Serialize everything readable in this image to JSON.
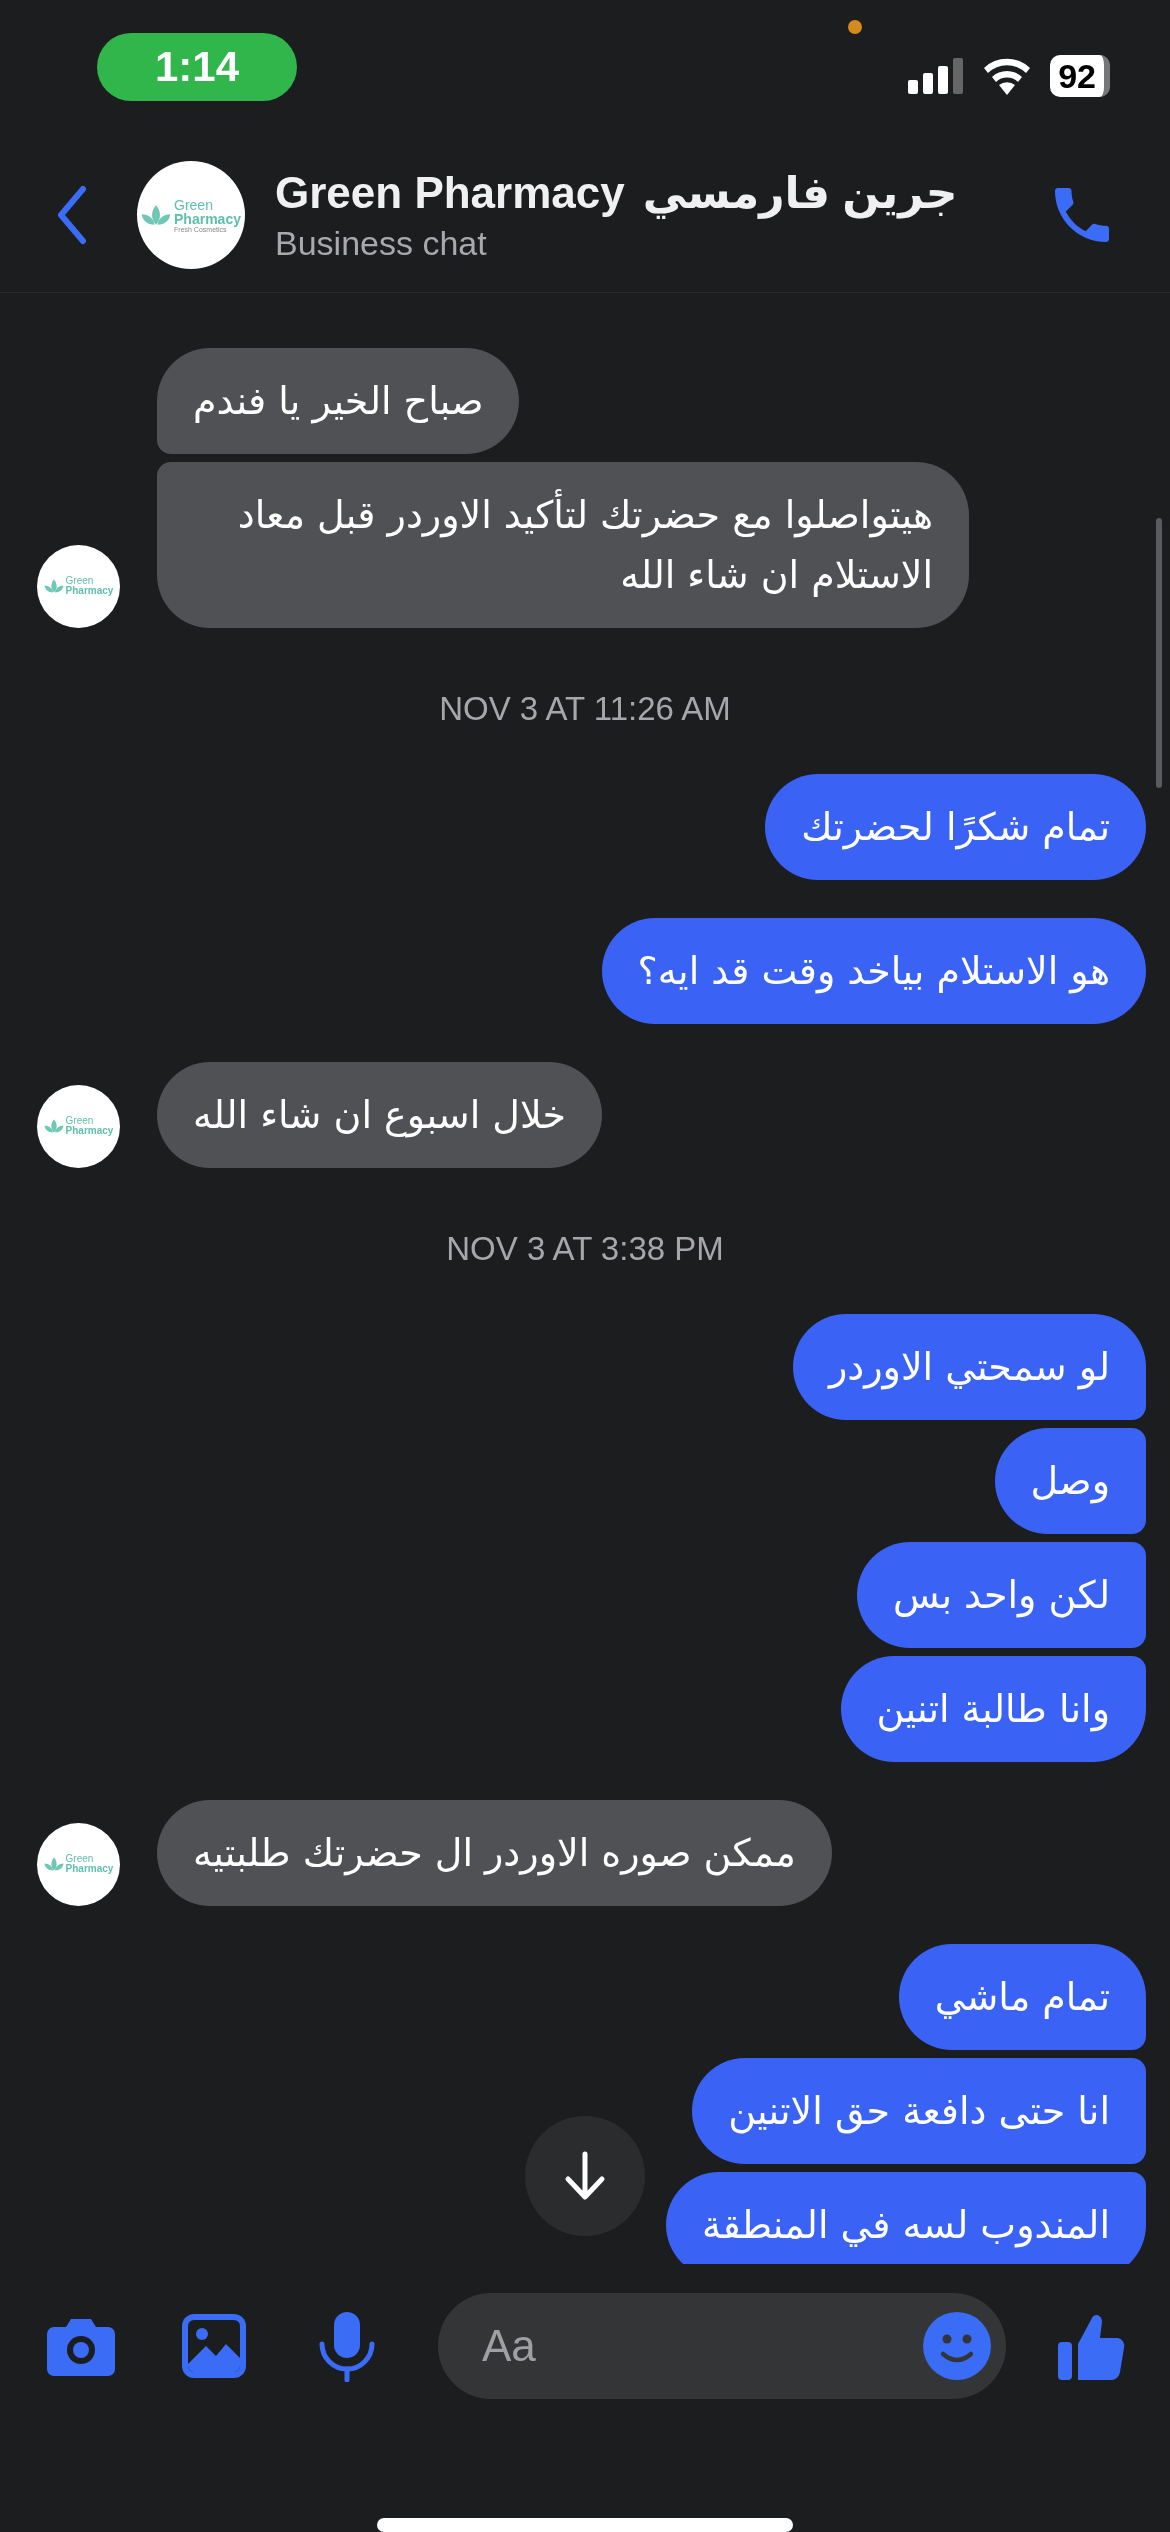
{
  "status_bar": {
    "time": "1:14",
    "battery": "92"
  },
  "header": {
    "title": "Green Pharmacy",
    "title_arabic": "جرين فارمسي",
    "subtitle": "Business chat",
    "logo": {
      "name_line_1": "Green",
      "name_line_2": "Pharmacy",
      "tagline": "Fresh Cosmetics"
    }
  },
  "messages": [
    {
      "kind": "incoming",
      "text": "صباح الخير يا فندم"
    },
    {
      "kind": "incoming",
      "text": "هيتواصلوا مع حضرتك لتأكيد الاوردر قبل معاد الاستلام ان شاء الله",
      "avatar": {
        "name_line_1": "Green",
        "name_line_2": "Pharmacy"
      }
    },
    {
      "kind": "timestamp",
      "text": "NOV 3 AT 11:26 AM"
    },
    {
      "kind": "outgoing",
      "text": "تمام شكرًا لحضرتك"
    },
    {
      "kind": "outgoing",
      "text": "هو الاستلام بياخد وقت قد ايه؟",
      "new_group": true
    },
    {
      "kind": "incoming",
      "text": "خلال اسبوع ان شاء الله",
      "avatar": {
        "name_line_1": "Green",
        "name_line_2": "Pharmacy"
      }
    },
    {
      "kind": "timestamp",
      "text": "NOV 3 AT 3:38 PM"
    },
    {
      "kind": "outgoing",
      "text": "لو سمحتي الاوردر"
    },
    {
      "kind": "outgoing",
      "text": "وصل"
    },
    {
      "kind": "outgoing",
      "text": "لكن واحد بس"
    },
    {
      "kind": "outgoing",
      "text": "وانا طالبة اتنين"
    },
    {
      "kind": "incoming",
      "text": "ممكن صوره الاوردر ال حضرتك طلبتيه",
      "avatar": {
        "name_line_1": "Green",
        "name_line_2": "Pharmacy"
      }
    },
    {
      "kind": "outgoing",
      "text": "تمام ماشي"
    },
    {
      "kind": "outgoing",
      "text": "انا حتى دافعة حق الاتنين"
    },
    {
      "kind": "outgoing",
      "text": "المندوب لسه في المنطقة"
    }
  ],
  "composer": {
    "placeholder": "Aa"
  }
}
